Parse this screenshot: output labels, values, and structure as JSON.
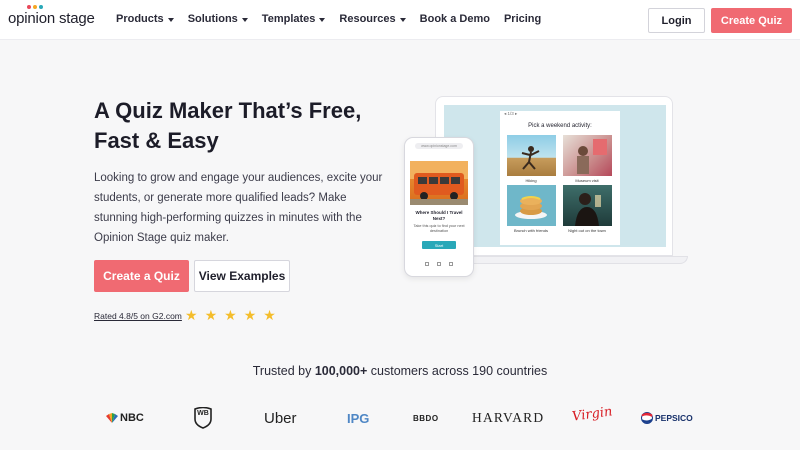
{
  "nav": {
    "logo_text": "opinion stage",
    "items": [
      {
        "label": "Products",
        "has_caret": true
      },
      {
        "label": "Solutions",
        "has_caret": true
      },
      {
        "label": "Templates",
        "has_caret": true
      },
      {
        "label": "Resources",
        "has_caret": true
      },
      {
        "label": "Book a Demo",
        "has_caret": false
      },
      {
        "label": "Pricing",
        "has_caret": false
      }
    ],
    "login_label": "Login",
    "create_quiz_label": "Create Quiz"
  },
  "hero": {
    "title_line1": "A Quiz Maker That’s Free,",
    "title_line2": "Fast & Easy",
    "description": "Looking to grow and engage your audiences, excite your students, or generate more qualified leads? Make stunning high-performing quizzes in minutes with the Opinion Stage quiz maker.",
    "primary_button": "Create a Quiz",
    "secondary_button": "View Examples",
    "rating_text": "Rated 4.8/5 on G2.com",
    "rating_stars": 5
  },
  "mockup": {
    "laptop_counter": "◂ 1/3 ▸",
    "laptop_question": "Pick a weekend activity:",
    "laptop_options": [
      "Hiking",
      "Museum visit",
      "Brunch with friends",
      "Night out on the town"
    ],
    "phone_url": "www.opinionstage.com",
    "phone_title": "Where Should I Travel Next?",
    "phone_sub": "Take this quiz to find your next destination",
    "phone_button": "Start"
  },
  "trust": {
    "prefix": "Trusted by ",
    "count": "100,000+",
    "suffix": " customers across 190 countries"
  },
  "customer_logos": {
    "nbc": "NBC",
    "wb": "WB",
    "uber": "Uber",
    "ipg": "IPG",
    "bbdo": "BBDO",
    "harvard": "HARVARD",
    "virgin": "Virgin",
    "pepsico": "PEPSICO"
  },
  "colors": {
    "accent": "#f06a72",
    "star": "#f4bd2b",
    "teal": "#29a8b8"
  }
}
